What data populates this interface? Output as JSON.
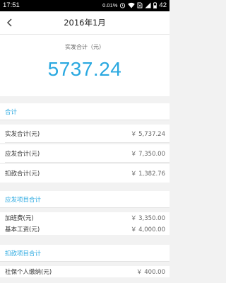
{
  "status_bar": {
    "time": "17:51",
    "battery_percent_text": "0.01%",
    "battery_level": "42"
  },
  "nav": {
    "title": "2016年1月"
  },
  "summary": {
    "label": "实发合计（元）",
    "amount": "5737.24",
    "amount_color": "#29a8e0"
  },
  "sections": {
    "total": {
      "title": "合计",
      "rows": [
        {
          "label": "实发合计(元)",
          "value": "￥ 5,737.24"
        },
        {
          "label": "应发合计(元)",
          "value": "￥ 7,350.00"
        },
        {
          "label": "扣款合计(元)",
          "value": "￥ 1,382.76"
        }
      ]
    },
    "payable": {
      "title": "应发项目合计",
      "rows": [
        {
          "label": "加班费(元)",
          "value": "￥ 3,350.00"
        },
        {
          "label": "基本工资(元)",
          "value": "￥ 4,000.00"
        }
      ]
    },
    "deduction": {
      "title": "扣款项目合计",
      "rows": [
        {
          "label": "社保个人缴纳(元)",
          "value": "￥ 400.00"
        }
      ]
    }
  }
}
